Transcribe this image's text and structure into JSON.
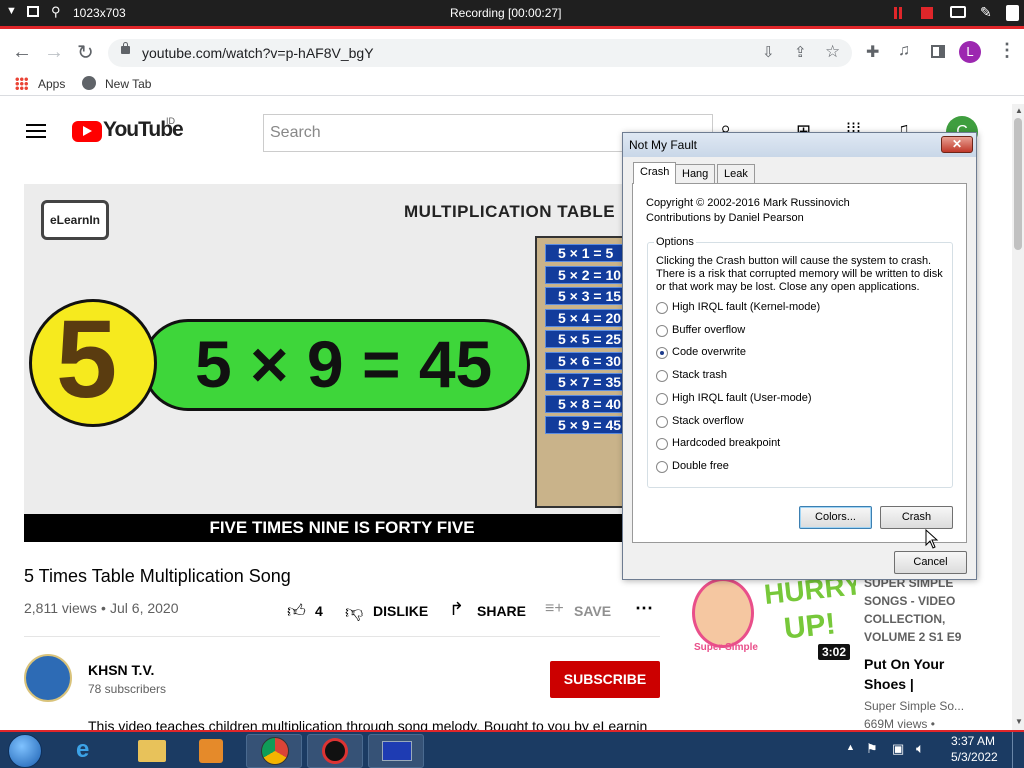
{
  "recorder": {
    "resolution": "1023x703",
    "status": "Recording [00:00:27]"
  },
  "browser": {
    "url": "youtube.com/watch?v=p-hAF8V_bgY",
    "profile_initial": "L",
    "bookmarks": [
      {
        "label": "Apps"
      },
      {
        "label": "New Tab"
      }
    ]
  },
  "youtube": {
    "logo_text": "YouTube",
    "region": "ID",
    "search_placeholder": "Search",
    "avatar_initial": "C",
    "video": {
      "brand": "eLearnIn",
      "banner": "MULTIPLICATION TABLE",
      "digit": "5",
      "equation": "5 × 9 = 45",
      "table_rows": [
        "5 × 1 = 5",
        "5 × 2 = 10",
        "5 × 3 = 15",
        "5 × 4 = 20",
        "5 × 5 = 25",
        "5 × 6 = 30",
        "5 × 7 = 35",
        "5 × 8 = 40",
        "5 × 9 = 45"
      ],
      "caption": "FIVE TIMES NINE IS FORTY FIVE"
    },
    "title": "5 Times Table Multiplication Song",
    "views": "2,811 views",
    "date": "Jul 6, 2020",
    "likes": "4",
    "dislike_label": "DISLIKE",
    "share_label": "SHARE",
    "save_label": "SAVE",
    "channel": {
      "name": "KHSN T.V.",
      "subscribers": "78 subscribers"
    },
    "subscribe_label": "SUBSCRIBE",
    "description": "This video teaches children multiplication through song melody. Bought to you by eLearnin",
    "recommended": {
      "title_top_lines": [
        "SUPER SIMPLE",
        "SONGS - VIDEO",
        "COLLECTION,",
        "VOLUME 2  S1 E9"
      ],
      "thumb_text": [
        "HURRY",
        "UP!"
      ],
      "thumb_logo": "Super Simple",
      "duration": "3:02",
      "title_lines": [
        "Put On Your",
        "Shoes |"
      ],
      "channel": "Super Simple So...",
      "views": "669M views •"
    }
  },
  "dialog": {
    "title": "Not My Fault",
    "tabs": [
      "Crash",
      "Hang",
      "Leak"
    ],
    "copyright": "Copyright © 2002-2016 Mark Russinovich",
    "contributions": "Contributions by Daniel Pearson",
    "options_label": "Options",
    "warning_lines": [
      "Clicking the Crash button will cause the system to crash.",
      "There is a risk that corrupted memory will be written to disk",
      "or that work may be lost. Close any open applications."
    ],
    "options": [
      {
        "label": "High IRQL fault (Kernel-mode)",
        "selected": false
      },
      {
        "label": "Buffer overflow",
        "selected": false
      },
      {
        "label": "Code overwrite",
        "selected": true
      },
      {
        "label": "Stack trash",
        "selected": false
      },
      {
        "label": "High IRQL fault (User-mode)",
        "selected": false
      },
      {
        "label": "Stack overflow",
        "selected": false
      },
      {
        "label": "Hardcoded breakpoint",
        "selected": false
      },
      {
        "label": "Double free",
        "selected": false
      }
    ],
    "colors_button": "Colors...",
    "crash_button": "Crash",
    "cancel_button": "Cancel"
  },
  "taskbar": {
    "time": "3:37 AM",
    "date": "5/3/2022"
  },
  "colors": {
    "youtube_red": "#ff0000",
    "subscribe_red": "#cc0000",
    "recording_red": "#e0262a",
    "taskbar": "#1b3b63"
  }
}
